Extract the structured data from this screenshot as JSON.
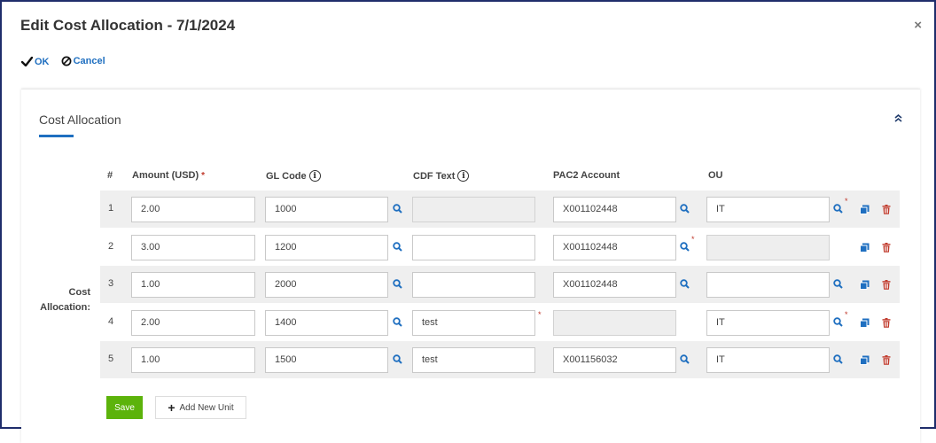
{
  "dialog": {
    "title": "Edit Cost Allocation - 7/1/2024",
    "close_glyph": "×",
    "ok_label": "OK",
    "cancel_label": "Cancel"
  },
  "section": {
    "title": "Cost Allocation",
    "side_label_line1": "Cost",
    "side_label_line2": "Allocation:"
  },
  "table": {
    "headers": {
      "num": "#",
      "amount": "Amount (USD)",
      "gl_code": "GL Code",
      "cdf_text": "CDF Text",
      "pac2_account": "PAC2 Account",
      "ou": "OU"
    },
    "required_marker": "*",
    "info_glyph": "i",
    "rows": [
      {
        "num": "1",
        "amount": "2.00",
        "gl_code": "1000",
        "cdf_text": "",
        "cdf_disabled": true,
        "cdf_required": false,
        "pac2": "X001102448",
        "pac2_disabled": false,
        "pac2_lookup": true,
        "pac2_required": false,
        "ou": "IT",
        "ou_disabled": false,
        "ou_lookup": true,
        "ou_required": true
      },
      {
        "num": "2",
        "amount": "3.00",
        "gl_code": "1200",
        "cdf_text": "",
        "cdf_disabled": false,
        "cdf_required": false,
        "pac2": "X001102448",
        "pac2_disabled": false,
        "pac2_lookup": true,
        "pac2_required": true,
        "ou": "",
        "ou_disabled": true,
        "ou_lookup": false,
        "ou_required": false
      },
      {
        "num": "3",
        "amount": "1.00",
        "gl_code": "2000",
        "cdf_text": "",
        "cdf_disabled": false,
        "cdf_required": false,
        "pac2": "X001102448",
        "pac2_disabled": false,
        "pac2_lookup": true,
        "pac2_required": false,
        "ou": "",
        "ou_disabled": false,
        "ou_lookup": true,
        "ou_required": false
      },
      {
        "num": "4",
        "amount": "2.00",
        "gl_code": "1400",
        "cdf_text": "test",
        "cdf_disabled": false,
        "cdf_required": true,
        "pac2": "",
        "pac2_disabled": true,
        "pac2_lookup": false,
        "pac2_required": false,
        "ou": "IT",
        "ou_disabled": false,
        "ou_lookup": true,
        "ou_required": true
      },
      {
        "num": "5",
        "amount": "1.00",
        "gl_code": "1500",
        "cdf_text": "test",
        "cdf_disabled": false,
        "cdf_required": false,
        "pac2": "X001156032",
        "pac2_disabled": false,
        "pac2_lookup": true,
        "pac2_required": false,
        "ou": "IT",
        "ou_disabled": false,
        "ou_lookup": true,
        "ou_required": false
      }
    ]
  },
  "buttons": {
    "save_label": "Save",
    "add_label": "Add New Unit",
    "add_glyph": "+"
  },
  "icons": {
    "ok": "check-icon",
    "cancel": "cancel-icon",
    "collapse": "chevron-double-up-icon",
    "lookup": "search-icon",
    "copy": "copy-icon",
    "delete": "trash-icon",
    "info": "info-icon"
  },
  "colors": {
    "link_blue": "#1f6fc0",
    "required_red": "#c0392b",
    "delete_red": "#c0392b",
    "save_green": "#5cb30b",
    "frame_navy": "#1f2d6b"
  }
}
